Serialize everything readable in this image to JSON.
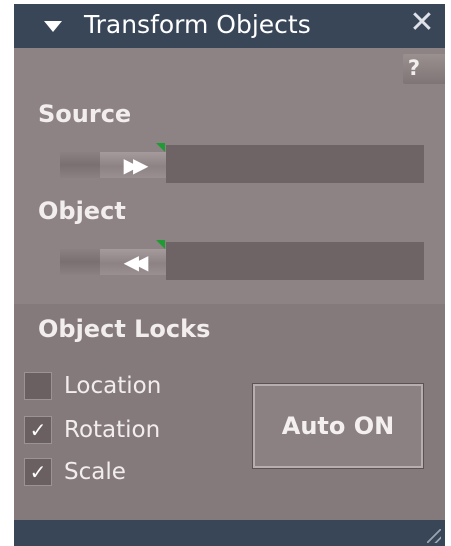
{
  "window": {
    "title": "Transform Objects",
    "collapse_icon": "triangle-down-icon",
    "close_glyph": "✕",
    "help_label": "?"
  },
  "source": {
    "label": "Source",
    "thumb_glyph": "▶▶",
    "thumb_icon": "fast-forward-icon"
  },
  "object": {
    "label": "Object",
    "thumb_glyph": "◀◀",
    "thumb_icon": "rewind-icon"
  },
  "locks": {
    "heading": "Object Locks",
    "items": [
      {
        "label": "Location",
        "checked": false,
        "mark": ""
      },
      {
        "label": "Rotation",
        "checked": true,
        "mark": "✓"
      },
      {
        "label": "Scale",
        "checked": true,
        "mark": "✓"
      }
    ],
    "auto_button_label": "Auto ON"
  },
  "colors": {
    "titlebar": "#384658",
    "panel": "#8e8384",
    "marker": "#1f9b33"
  }
}
